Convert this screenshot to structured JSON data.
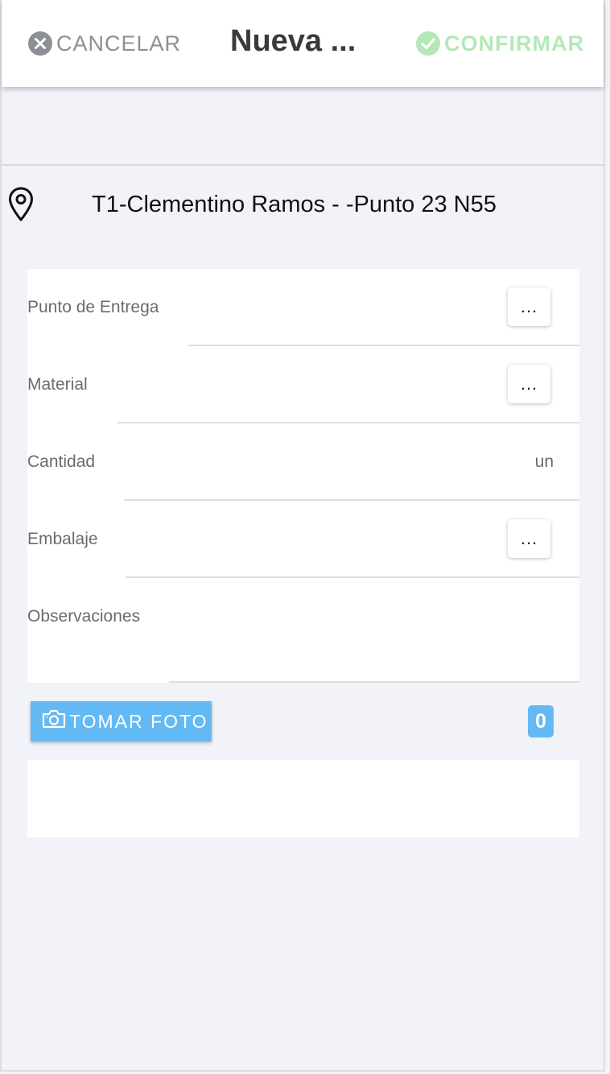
{
  "header": {
    "cancel_label": "CANCELAR",
    "title": "Nueva ...",
    "confirm_label": "CONFIRMAR"
  },
  "location": {
    "icon": "map-pin-icon",
    "text": "T1-Clementino Ramos - -Punto 23 N55"
  },
  "form": {
    "fields": [
      {
        "label": "Punto de Entrega",
        "action": "..."
      },
      {
        "label": "Material",
        "action": "..."
      },
      {
        "label": "Cantidad",
        "unit": "un"
      },
      {
        "label": "Embalaje",
        "action": "..."
      },
      {
        "label": "Observaciones"
      }
    ]
  },
  "photo": {
    "button_label": "TOMAR FOTO",
    "icon": "camera-icon",
    "count": "0"
  },
  "colors": {
    "accent": "#63b9f3",
    "confirm": "#b4e8b7",
    "cancel": "#8d8f96",
    "background": "#f2f3f8"
  }
}
